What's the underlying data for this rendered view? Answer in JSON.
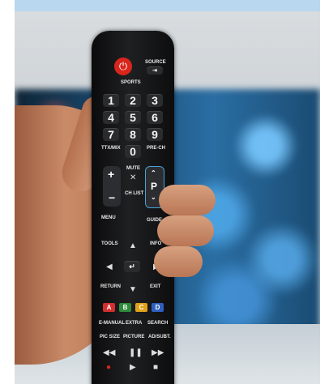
{
  "remote": {
    "source_label": "SOURCE",
    "sports_label": "SPORTS",
    "numbers": [
      "1",
      "2",
      "3",
      "4",
      "5",
      "6",
      "7",
      "8",
      "9",
      "0"
    ],
    "ttx_label": "TTX/MIX",
    "prech_label": "PRE-CH",
    "mute_label": "MUTE",
    "chlist_label": "CH LIST",
    "ch_label": "P",
    "menu_label": "MENU",
    "guide_label": "GUIDE",
    "tools_label": "TOOLS",
    "info_label": "INFO",
    "return_label": "RETURN",
    "exit_label": "EXIT",
    "color_buttons": [
      "A",
      "B",
      "C",
      "D"
    ],
    "emanual_label": "E-MANUAL",
    "extra_label": "EXTRA",
    "search_label": "SEARCH",
    "picsize_label": "PIC SIZE",
    "picture_label": "PICTURE",
    "adsubt_label": "AD/SUBT."
  },
  "colors": {
    "power": "#d9261c",
    "button_a": "#d32f2f",
    "button_b": "#2e8b3a",
    "button_c": "#e0a21b",
    "button_d": "#2f5fbf"
  }
}
